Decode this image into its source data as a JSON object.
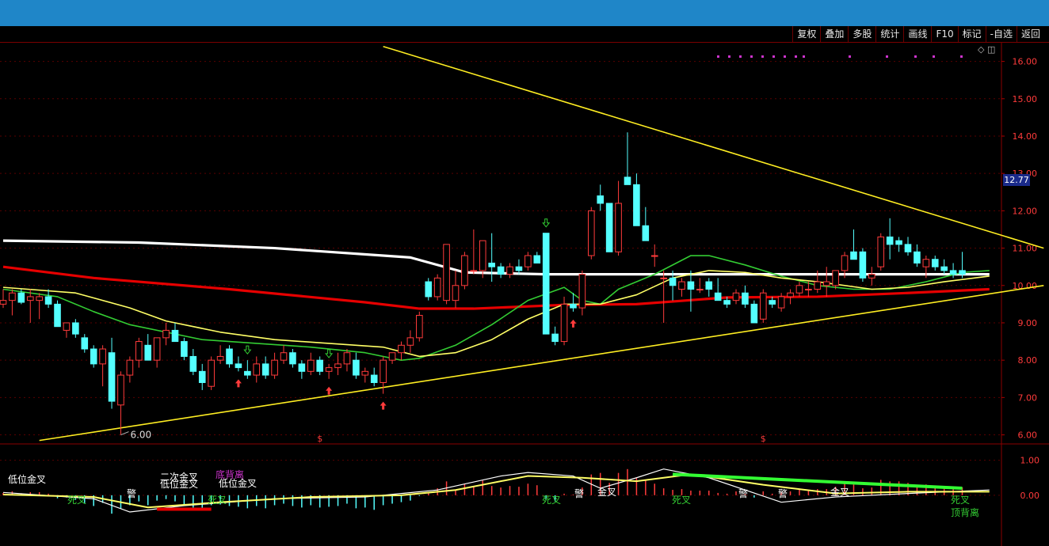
{
  "toolbar": {
    "items": [
      "复权",
      "叠加",
      "多股",
      "统计",
      "画线",
      "F10",
      "标记",
      "-自选",
      "返回"
    ]
  },
  "current_price_label": "12.77",
  "icons": {
    "diamond": "◇",
    "square": "◫"
  },
  "colors": {
    "up": "#ff3b3b",
    "down": "#54ffff",
    "ma_white": "#ffffff",
    "ma_red": "#e60000",
    "ma_green": "#33cc33",
    "ma_yellow": "#ffff66",
    "trend": "#ffee22",
    "grid": "#5a0000",
    "axis_text": "#ff3b3b",
    "dots": "#cc33cc"
  },
  "chart_data": [
    {
      "type": "candlestick",
      "ylim": [
        5.8,
        16.5
      ],
      "y_ticks": [
        "6.00",
        "7.00",
        "8.00",
        "9.00",
        "10.00",
        "11.00",
        "12.00",
        "13.00",
        "14.00",
        "15.00",
        "16.00"
      ],
      "low_marker_label": "6.00",
      "candles": [
        {
          "o": 9.5,
          "h": 9.9,
          "l": 9.4,
          "c": 9.6
        },
        {
          "o": 9.6,
          "h": 9.9,
          "l": 9.2,
          "c": 9.8
        },
        {
          "o": 9.8,
          "h": 9.9,
          "l": 9.5,
          "c": 9.55
        },
        {
          "o": 9.6,
          "h": 9.9,
          "l": 9.0,
          "c": 9.7
        },
        {
          "o": 9.6,
          "h": 9.8,
          "l": 9.1,
          "c": 9.7
        },
        {
          "o": 9.7,
          "h": 9.9,
          "l": 9.4,
          "c": 9.5
        },
        {
          "o": 9.5,
          "h": 9.6,
          "l": 8.9,
          "c": 8.9
        },
        {
          "o": 8.8,
          "h": 9.0,
          "l": 8.6,
          "c": 9.0
        },
        {
          "o": 9.0,
          "h": 9.1,
          "l": 8.6,
          "c": 8.7
        },
        {
          "o": 8.6,
          "h": 8.7,
          "l": 8.2,
          "c": 8.3
        },
        {
          "o": 8.3,
          "h": 8.4,
          "l": 7.8,
          "c": 7.9
        },
        {
          "o": 7.9,
          "h": 8.4,
          "l": 7.3,
          "c": 8.3
        },
        {
          "o": 8.2,
          "h": 8.6,
          "l": 6.7,
          "c": 6.9
        },
        {
          "o": 6.8,
          "h": 7.7,
          "l": 6.0,
          "c": 7.6
        },
        {
          "o": 7.6,
          "h": 8.1,
          "l": 7.4,
          "c": 8.0
        },
        {
          "o": 8.0,
          "h": 8.6,
          "l": 7.8,
          "c": 8.5
        },
        {
          "o": 8.4,
          "h": 8.7,
          "l": 8.0,
          "c": 8.0
        },
        {
          "o": 8.0,
          "h": 8.6,
          "l": 7.8,
          "c": 8.6
        },
        {
          "o": 8.6,
          "h": 9.0,
          "l": 8.4,
          "c": 8.8
        },
        {
          "o": 8.8,
          "h": 9.0,
          "l": 8.5,
          "c": 8.5
        },
        {
          "o": 8.5,
          "h": 8.6,
          "l": 8.0,
          "c": 8.1
        },
        {
          "o": 8.1,
          "h": 8.3,
          "l": 7.6,
          "c": 7.7
        },
        {
          "o": 7.7,
          "h": 7.9,
          "l": 7.2,
          "c": 7.4
        },
        {
          "o": 7.3,
          "h": 8.1,
          "l": 7.2,
          "c": 8.0
        },
        {
          "o": 8.0,
          "h": 8.4,
          "l": 7.9,
          "c": 8.1
        },
        {
          "o": 8.3,
          "h": 8.4,
          "l": 7.8,
          "c": 7.9
        },
        {
          "o": 7.9,
          "h": 8.1,
          "l": 7.7,
          "c": 7.8
        },
        {
          "o": 7.7,
          "h": 8.0,
          "l": 7.5,
          "c": 7.6
        },
        {
          "o": 7.6,
          "h": 8.1,
          "l": 7.4,
          "c": 7.9
        },
        {
          "o": 7.9,
          "h": 8.1,
          "l": 7.5,
          "c": 7.6
        },
        {
          "o": 7.6,
          "h": 8.2,
          "l": 7.5,
          "c": 8.0
        },
        {
          "o": 8.0,
          "h": 8.4,
          "l": 7.9,
          "c": 8.2
        },
        {
          "o": 8.2,
          "h": 8.3,
          "l": 7.8,
          "c": 7.9
        },
        {
          "o": 7.9,
          "h": 8.0,
          "l": 7.5,
          "c": 7.7
        },
        {
          "o": 7.7,
          "h": 8.2,
          "l": 7.6,
          "c": 8.0
        },
        {
          "o": 8.0,
          "h": 8.1,
          "l": 7.6,
          "c": 7.7
        },
        {
          "o": 7.7,
          "h": 7.9,
          "l": 7.5,
          "c": 7.8
        },
        {
          "o": 7.8,
          "h": 8.2,
          "l": 7.6,
          "c": 7.9
        },
        {
          "o": 7.9,
          "h": 8.3,
          "l": 7.7,
          "c": 8.2
        },
        {
          "o": 8.0,
          "h": 8.2,
          "l": 7.5,
          "c": 7.6
        },
        {
          "o": 7.6,
          "h": 7.8,
          "l": 7.4,
          "c": 7.7
        },
        {
          "o": 7.6,
          "h": 7.8,
          "l": 7.3,
          "c": 7.4
        },
        {
          "o": 7.4,
          "h": 8.1,
          "l": 7.1,
          "c": 8.0
        },
        {
          "o": 8.0,
          "h": 8.2,
          "l": 7.9,
          "c": 8.2
        },
        {
          "o": 8.2,
          "h": 8.5,
          "l": 8.0,
          "c": 8.4
        },
        {
          "o": 8.4,
          "h": 8.8,
          "l": 8.2,
          "c": 8.6
        },
        {
          "o": 8.6,
          "h": 9.3,
          "l": 8.5,
          "c": 9.2
        },
        {
          "o": 10.1,
          "h": 10.2,
          "l": 9.6,
          "c": 9.7
        },
        {
          "o": 9.7,
          "h": 10.3,
          "l": 9.6,
          "c": 10.2
        },
        {
          "o": 9.6,
          "h": 11.1,
          "l": 9.5,
          "c": 11.1
        },
        {
          "o": 9.6,
          "h": 10.4,
          "l": 9.4,
          "c": 10.0
        },
        {
          "o": 10.0,
          "h": 10.9,
          "l": 9.9,
          "c": 10.8
        },
        {
          "o": 10.4,
          "h": 11.5,
          "l": 10.3,
          "c": 10.4
        },
        {
          "o": 10.4,
          "h": 11.1,
          "l": 10.2,
          "c": 11.2
        },
        {
          "o": 10.6,
          "h": 11.4,
          "l": 10.1,
          "c": 10.5
        },
        {
          "o": 10.5,
          "h": 10.6,
          "l": 10.2,
          "c": 10.3
        },
        {
          "o": 10.3,
          "h": 10.6,
          "l": 10.2,
          "c": 10.5
        },
        {
          "o": 10.5,
          "h": 10.7,
          "l": 10.3,
          "c": 10.4
        },
        {
          "o": 10.5,
          "h": 10.9,
          "l": 10.4,
          "c": 10.8
        },
        {
          "o": 10.8,
          "h": 10.9,
          "l": 10.6,
          "c": 10.6
        },
        {
          "o": 11.4,
          "h": 11.4,
          "l": 8.7,
          "c": 8.7
        },
        {
          "o": 8.7,
          "h": 8.9,
          "l": 8.4,
          "c": 8.5
        },
        {
          "o": 8.5,
          "h": 9.7,
          "l": 8.4,
          "c": 9.5
        },
        {
          "o": 9.5,
          "h": 9.8,
          "l": 9.3,
          "c": 9.4
        },
        {
          "o": 9.4,
          "h": 10.4,
          "l": 9.2,
          "c": 10.3
        },
        {
          "o": 10.8,
          "h": 12.1,
          "l": 10.7,
          "c": 12.0
        },
        {
          "o": 12.4,
          "h": 12.7,
          "l": 12.0,
          "c": 12.2
        },
        {
          "o": 12.2,
          "h": 12.2,
          "l": 10.9,
          "c": 10.9
        },
        {
          "o": 10.9,
          "h": 12.8,
          "l": 10.8,
          "c": 12.2
        },
        {
          "o": 12.9,
          "h": 14.1,
          "l": 12.8,
          "c": 12.7
        },
        {
          "o": 12.7,
          "h": 13.0,
          "l": 11.6,
          "c": 11.6
        },
        {
          "o": 11.6,
          "h": 12.1,
          "l": 11.2,
          "c": 11.2
        },
        {
          "o": 10.8,
          "h": 11.1,
          "l": 10.5,
          "c": 10.8
        },
        {
          "o": 10.2,
          "h": 10.4,
          "l": 9.0,
          "c": 10.2
        },
        {
          "o": 10.2,
          "h": 10.4,
          "l": 9.6,
          "c": 10.0
        },
        {
          "o": 9.9,
          "h": 10.2,
          "l": 9.7,
          "c": 10.1
        },
        {
          "o": 10.1,
          "h": 10.4,
          "l": 9.3,
          "c": 9.9
        },
        {
          "o": 9.9,
          "h": 10.2,
          "l": 9.8,
          "c": 9.9
        },
        {
          "o": 10.1,
          "h": 10.2,
          "l": 9.7,
          "c": 9.9
        },
        {
          "o": 9.8,
          "h": 10.2,
          "l": 9.6,
          "c": 9.6
        },
        {
          "o": 9.6,
          "h": 9.7,
          "l": 9.4,
          "c": 9.5
        },
        {
          "o": 9.6,
          "h": 9.9,
          "l": 9.5,
          "c": 9.8
        },
        {
          "o": 9.8,
          "h": 10.0,
          "l": 9.4,
          "c": 9.5
        },
        {
          "o": 9.5,
          "h": 9.6,
          "l": 9.0,
          "c": 9.0
        },
        {
          "o": 9.1,
          "h": 9.9,
          "l": 9.0,
          "c": 9.8
        },
        {
          "o": 9.6,
          "h": 9.7,
          "l": 9.4,
          "c": 9.5
        },
        {
          "o": 9.4,
          "h": 9.8,
          "l": 9.3,
          "c": 9.7
        },
        {
          "o": 9.7,
          "h": 9.9,
          "l": 9.5,
          "c": 9.8
        },
        {
          "o": 9.8,
          "h": 10.1,
          "l": 9.7,
          "c": 10.0
        },
        {
          "o": 9.9,
          "h": 10.1,
          "l": 9.7,
          "c": 9.9
        },
        {
          "o": 9.9,
          "h": 10.4,
          "l": 9.8,
          "c": 10.1
        },
        {
          "o": 10.0,
          "h": 10.5,
          "l": 9.7,
          "c": 10.1
        },
        {
          "o": 10.0,
          "h": 10.4,
          "l": 9.9,
          "c": 10.4
        },
        {
          "o": 10.4,
          "h": 10.9,
          "l": 10.2,
          "c": 10.8
        },
        {
          "o": 10.9,
          "h": 11.5,
          "l": 10.8,
          "c": 10.7
        },
        {
          "o": 10.9,
          "h": 11.0,
          "l": 10.1,
          "c": 10.2
        },
        {
          "o": 10.2,
          "h": 10.5,
          "l": 10.0,
          "c": 10.3
        },
        {
          "o": 10.5,
          "h": 11.4,
          "l": 10.4,
          "c": 11.3
        },
        {
          "o": 11.3,
          "h": 11.8,
          "l": 10.7,
          "c": 11.1
        },
        {
          "o": 11.2,
          "h": 11.3,
          "l": 10.9,
          "c": 11.1
        },
        {
          "o": 11.1,
          "h": 11.3,
          "l": 10.8,
          "c": 10.9
        },
        {
          "o": 10.9,
          "h": 11.1,
          "l": 10.5,
          "c": 10.6
        },
        {
          "o": 10.5,
          "h": 10.8,
          "l": 10.2,
          "c": 10.7
        },
        {
          "o": 10.7,
          "h": 10.8,
          "l": 10.4,
          "c": 10.5
        },
        {
          "o": 10.5,
          "h": 10.7,
          "l": 10.3,
          "c": 10.4
        },
        {
          "o": 10.4,
          "h": 10.6,
          "l": 10.2,
          "c": 10.3
        },
        {
          "o": 10.4,
          "h": 10.9,
          "l": 10.2,
          "c": 10.3
        }
      ],
      "moving_averages": [
        {
          "color": "#ffffff",
          "points": [
            [
              0,
              11.2
            ],
            [
              15,
              11.15
            ],
            [
              30,
              11.0
            ],
            [
              45,
              10.75
            ],
            [
              51,
              10.35
            ],
            [
              60,
              10.3
            ],
            [
              75,
              10.3
            ],
            [
              90,
              10.3
            ],
            [
              109,
              10.3
            ]
          ]
        },
        {
          "color": "#e60000",
          "points": [
            [
              0,
              10.5
            ],
            [
              10,
              10.2
            ],
            [
              25,
              9.9
            ],
            [
              40,
              9.55
            ],
            [
              46,
              9.38
            ],
            [
              52,
              9.38
            ],
            [
              62,
              9.48
            ],
            [
              70,
              9.5
            ],
            [
              80,
              9.68
            ],
            [
              90,
              9.7
            ],
            [
              100,
              9.8
            ],
            [
              109,
              9.9
            ]
          ]
        },
        {
          "color": "#33cc33",
          "points": [
            [
              0,
              9.9
            ],
            [
              6,
              9.7
            ],
            [
              10,
              9.3
            ],
            [
              14,
              8.95
            ],
            [
              18,
              8.75
            ],
            [
              22,
              8.55
            ],
            [
              28,
              8.45
            ],
            [
              34,
              8.35
            ],
            [
              40,
              8.2
            ],
            [
              44,
              8.0
            ],
            [
              46,
              8.05
            ],
            [
              50,
              8.4
            ],
            [
              54,
              8.95
            ],
            [
              58,
              9.6
            ],
            [
              62,
              9.95
            ],
            [
              64,
              9.6
            ],
            [
              66,
              9.5
            ],
            [
              68,
              9.9
            ],
            [
              72,
              10.3
            ],
            [
              76,
              10.8
            ],
            [
              78,
              10.8
            ],
            [
              82,
              10.55
            ],
            [
              86,
              10.25
            ],
            [
              90,
              10.0
            ],
            [
              94,
              9.9
            ],
            [
              98,
              9.9
            ],
            [
              102,
              10.1
            ],
            [
              106,
              10.35
            ],
            [
              109,
              10.4
            ]
          ]
        },
        {
          "color": "#ffff66",
          "points": [
            [
              0,
              9.95
            ],
            [
              8,
              9.8
            ],
            [
              14,
              9.4
            ],
            [
              18,
              9.05
            ],
            [
              24,
              8.75
            ],
            [
              30,
              8.55
            ],
            [
              36,
              8.45
            ],
            [
              42,
              8.35
            ],
            [
              46,
              8.1
            ],
            [
              50,
              8.2
            ],
            [
              54,
              8.55
            ],
            [
              58,
              9.1
            ],
            [
              62,
              9.5
            ],
            [
              66,
              9.5
            ],
            [
              70,
              9.75
            ],
            [
              74,
              10.2
            ],
            [
              78,
              10.4
            ],
            [
              82,
              10.35
            ],
            [
              86,
              10.2
            ],
            [
              90,
              10.1
            ],
            [
              96,
              9.9
            ],
            [
              100,
              9.95
            ],
            [
              104,
              10.1
            ],
            [
              109,
              10.25
            ]
          ]
        }
      ],
      "trendlines": [
        {
          "from": [
            42,
            16.4
          ],
          "to": [
            115,
            11.0
          ]
        },
        {
          "from": [
            4,
            5.85
          ],
          "to": [
            115,
            10.0
          ]
        }
      ],
      "arrows": [
        {
          "i": 26,
          "dir": "up"
        },
        {
          "i": 36,
          "dir": "up"
        },
        {
          "i": 42,
          "dir": "up"
        },
        {
          "i": 63,
          "dir": "up"
        },
        {
          "i": 27,
          "dir": "down"
        },
        {
          "i": 36,
          "dir": "down"
        },
        {
          "i": 60,
          "dir": "down"
        }
      ],
      "s_markers": [
        35,
        84
      ]
    },
    {
      "type": "macd",
      "ylim": [
        -1.0,
        1.4
      ],
      "y_ticks": [
        "0.00",
        "1.00"
      ],
      "annotations": [
        "低位金叉",
        "死叉",
        "二次金叉",
        "低位金叉",
        "底背离",
        "低位金叉",
        "死叉",
        "金叉",
        "死叉",
        "金叉",
        "死叉",
        "死叉",
        "顶背离",
        "警",
        "警",
        "警",
        "警"
      ]
    }
  ]
}
